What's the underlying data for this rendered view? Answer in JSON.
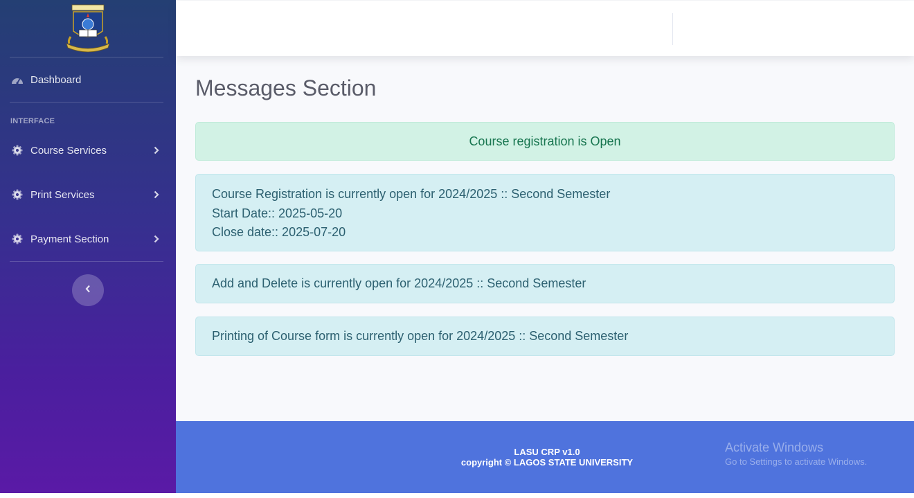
{
  "sidebar": {
    "dashboard": {
      "label": "Dashboard",
      "icon": "tachometer-icon"
    },
    "heading": "INTERFACE",
    "items": [
      {
        "label": "Course Services",
        "icon": "gear-icon"
      },
      {
        "label": "Print Services",
        "icon": "gear-icon"
      },
      {
        "label": "Payment Section",
        "icon": "gear-icon"
      }
    ],
    "toggle_icon": "chevron-left-icon"
  },
  "main": {
    "title": "Messages Section",
    "alerts": {
      "status": "Course registration is Open",
      "registration": {
        "line1": "Course Registration is currently open for 2024/2025 :: Second Semester",
        "line2": "Start Date:: 2025-05-20",
        "line3": "Close date:: 2025-07-20"
      },
      "add_delete": "Add and Delete is currently open for 2024/2025 :: Second Semester",
      "printing": "Printing of Course form is currently open for 2024/2025 :: Second Semester"
    }
  },
  "footer": {
    "line1": "LASU CRP v1.0",
    "line2": "copyright © LAGOS STATE UNIVERSITY"
  },
  "watermark": {
    "line1": "Activate Windows",
    "line2": "Go to Settings to activate Windows."
  },
  "colors": {
    "footer_bg": "#4f73dd",
    "success_bg": "#d2f2e5",
    "info_bg": "#d5eff3",
    "sidebar_top": "#243f73",
    "sidebar_bottom": "#5a1aa6"
  }
}
